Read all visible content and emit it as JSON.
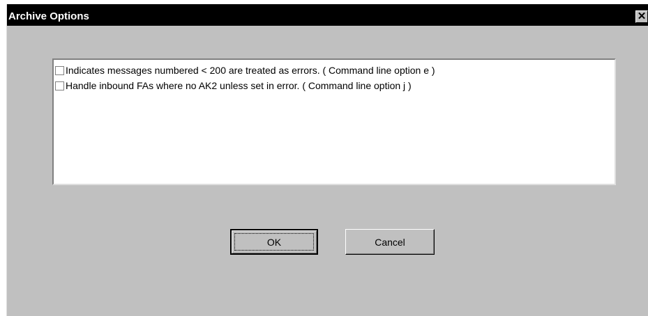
{
  "window": {
    "title": "Archive Options",
    "close_glyph": "✕"
  },
  "options": {
    "items": [
      {
        "label": "Indicates messages numbered < 200 are treated as errors. ( Command line option e )",
        "checked": false
      },
      {
        "label": "Handle inbound FAs where no AK2 unless set in error. ( Command line option j )",
        "checked": false
      }
    ]
  },
  "buttons": {
    "ok_label": "OK",
    "cancel_label": "Cancel"
  },
  "colors": {
    "titlebar": "#000000",
    "dialog_bg": "#c0c0c0",
    "list_bg": "#ffffff"
  }
}
